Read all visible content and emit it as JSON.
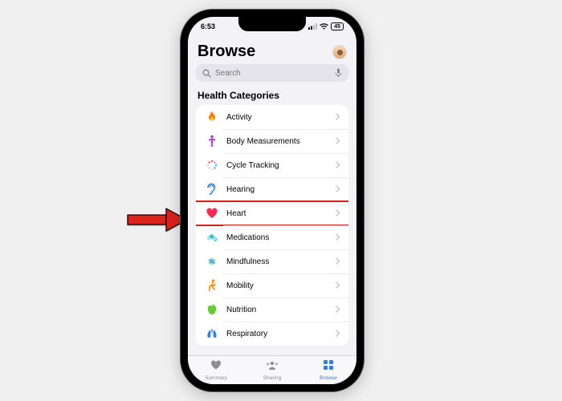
{
  "status": {
    "time": "6:53",
    "battery": "45"
  },
  "header": {
    "title": "Browse"
  },
  "search": {
    "placeholder": "Search"
  },
  "section": {
    "title": "Health Categories"
  },
  "categories": [
    {
      "label": "Activity"
    },
    {
      "label": "Body Measurements"
    },
    {
      "label": "Cycle Tracking"
    },
    {
      "label": "Hearing"
    },
    {
      "label": "Heart"
    },
    {
      "label": "Medications"
    },
    {
      "label": "Mindfulness"
    },
    {
      "label": "Mobility"
    },
    {
      "label": "Nutrition"
    },
    {
      "label": "Respiratory"
    }
  ],
  "highlight_index": 4,
  "tabs": [
    {
      "label": "Summary"
    },
    {
      "label": "Sharing"
    },
    {
      "label": "Browse"
    }
  ],
  "active_tab": 2
}
